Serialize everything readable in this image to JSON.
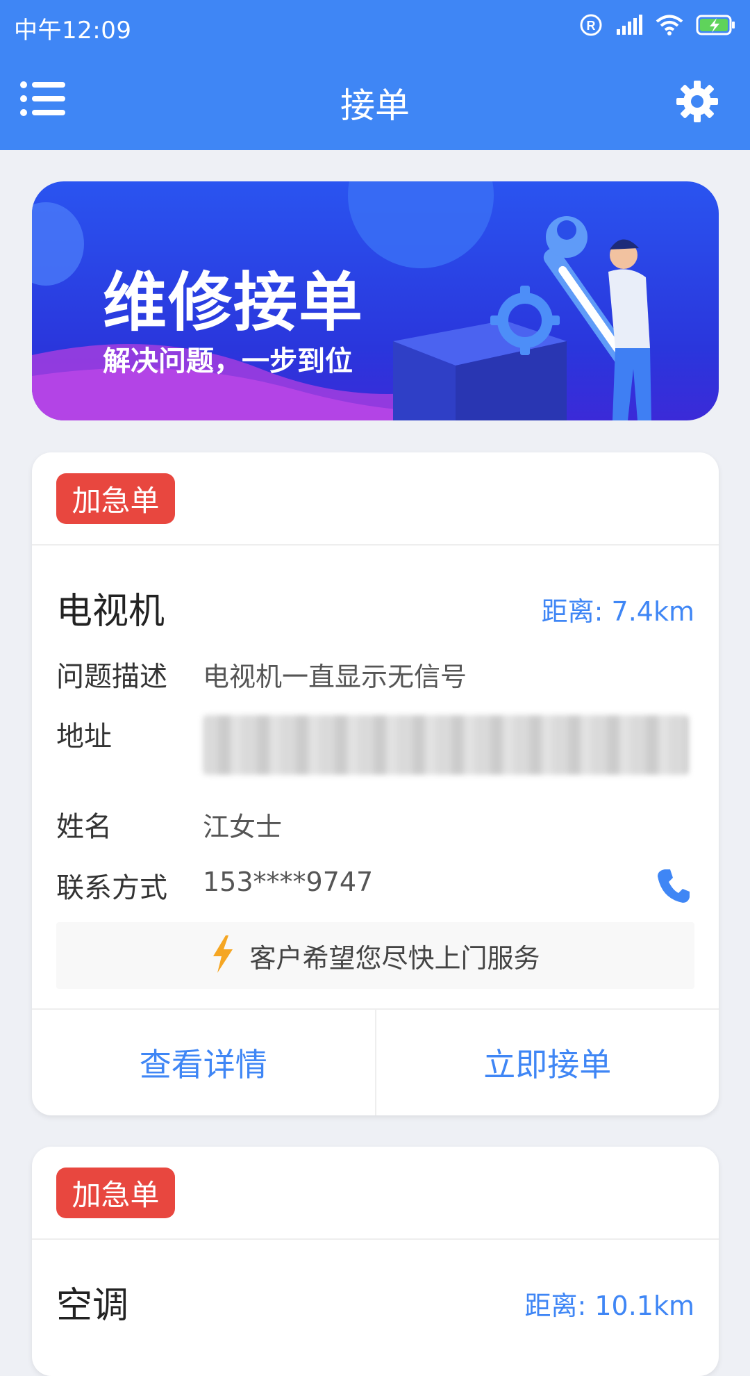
{
  "status_bar": {
    "time": "中午12:09",
    "icons": [
      "registered-icon",
      "signal-icon",
      "wifi-icon",
      "battery-charging-icon"
    ]
  },
  "app_bar": {
    "title": "接单",
    "left_icon": "menu-list-icon",
    "right_icon": "gear-icon"
  },
  "banner": {
    "title": "维修接单",
    "subtitle": "解决问题，一步到位"
  },
  "orders": [
    {
      "badge": "加急单",
      "device": "电视机",
      "distance": "距离: 7.4km",
      "fields": {
        "problem_label": "问题描述",
        "problem_value": "电视机一直显示无信号",
        "address_label": "地址",
        "name_label": "姓名",
        "name_value": "江女士",
        "contact_label": "联系方式",
        "contact_value": "153****9747"
      },
      "hint": "客户希望您尽快上门服务",
      "actions": {
        "details": "查看详情",
        "accept": "立即接单"
      }
    },
    {
      "badge": "加急单",
      "device": "空调",
      "distance": "距离: 10.1km"
    }
  ],
  "colors": {
    "primary": "#3f86f5",
    "urgent": "#e8473f",
    "background": "#eef0f5",
    "hint_icon": "#f5a623"
  }
}
